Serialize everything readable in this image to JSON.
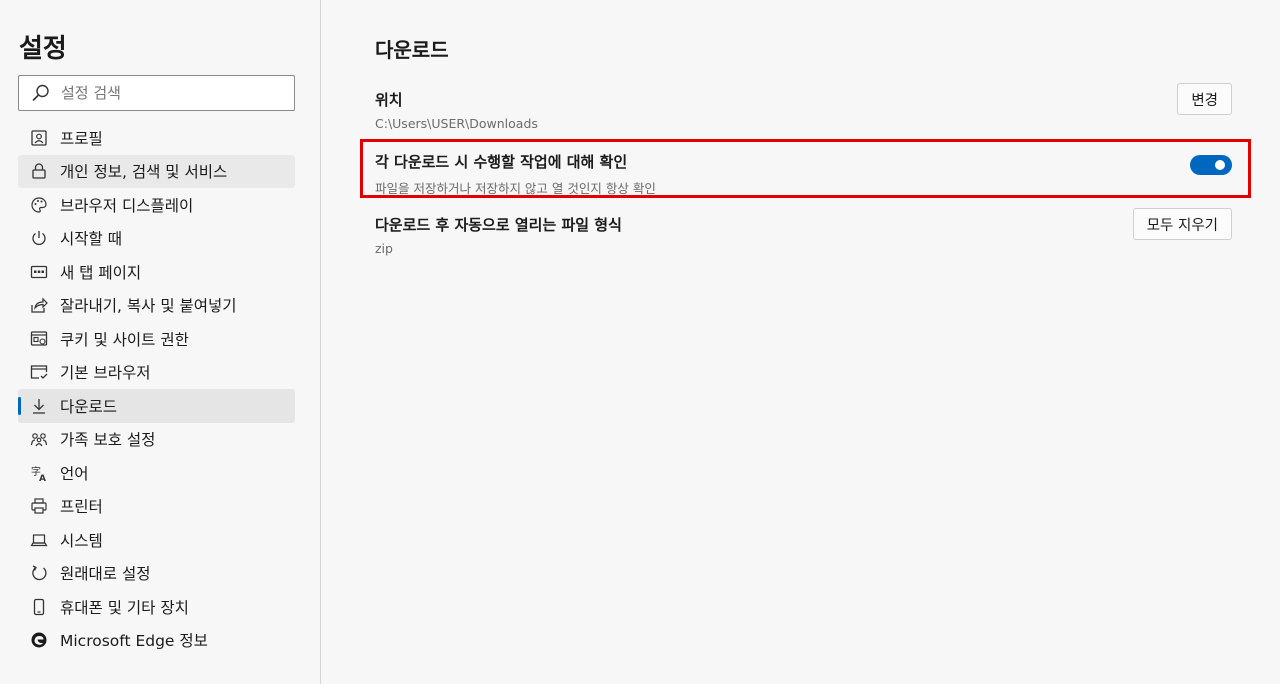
{
  "sidebar": {
    "title": "설정",
    "search": {
      "placeholder": "설정 검색",
      "value": ""
    },
    "items": [
      {
        "label": "프로필",
        "icon": "profile-icon"
      },
      {
        "label": "개인 정보, 검색 및 서비스",
        "icon": "lock-icon"
      },
      {
        "label": "브라우저 디스플레이",
        "icon": "palette-icon"
      },
      {
        "label": "시작할 때",
        "icon": "power-icon"
      },
      {
        "label": "새 탭 페이지",
        "icon": "new-tab-icon"
      },
      {
        "label": "잘라내기, 복사 및 붙여넣기",
        "icon": "share-icon"
      },
      {
        "label": "쿠키 및 사이트 권한",
        "icon": "cookie-site-icon"
      },
      {
        "label": "기본 브라우저",
        "icon": "browser-window-icon"
      },
      {
        "label": "다운로드",
        "icon": "download-icon"
      },
      {
        "label": "가족 보호 설정",
        "icon": "family-icon"
      },
      {
        "label": "언어",
        "icon": "language-icon"
      },
      {
        "label": "프린터",
        "icon": "printer-icon"
      },
      {
        "label": "시스템",
        "icon": "laptop-icon"
      },
      {
        "label": "원래대로 설정",
        "icon": "reset-icon"
      },
      {
        "label": "휴대폰 및 기타 장치",
        "icon": "phone-icon"
      },
      {
        "label": "Microsoft Edge 정보",
        "icon": "edge-logo-icon"
      }
    ]
  },
  "main": {
    "title": "다운로드",
    "location": {
      "title": "위치",
      "path": "C:\\Users\\USER\\Downloads",
      "button": "변경"
    },
    "ask": {
      "title": "각 다운로드 시 수행할 작업에 대해 확인",
      "description": "파일을 저장하거나 저장하지 않고 열 것인지 항상 확인",
      "enabled": true
    },
    "auto_open": {
      "title": "다운로드 후 자동으로 열리는 파일 형식",
      "value": "zip",
      "button": "모두 지우기"
    }
  },
  "colors": {
    "accent": "#0067c0",
    "highlight_border": "#e00000"
  }
}
